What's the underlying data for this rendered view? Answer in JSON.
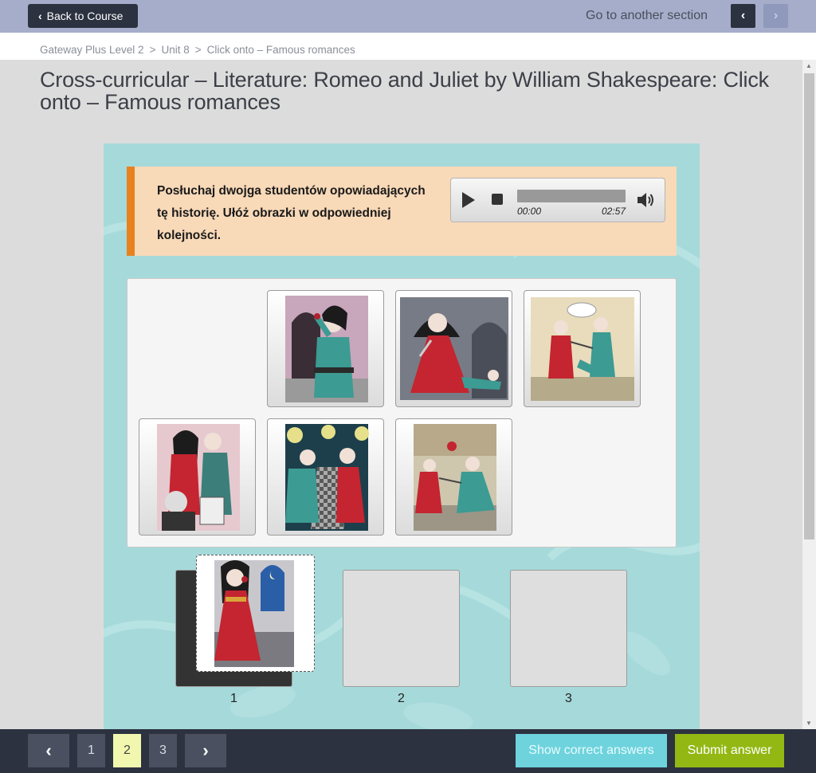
{
  "header": {
    "back_label": "Back to Course",
    "goto_label": "Go to another section",
    "prev_icon": "‹",
    "next_icon": "›"
  },
  "breadcrumb": {
    "items": [
      "Gateway Plus Level 2",
      "Unit 8",
      "Click onto – Famous romances"
    ],
    "separator": ">"
  },
  "page": {
    "title": "Cross-curricular – Literature: Romeo and Juliet by William Shakespeare: Click onto – Famous romances"
  },
  "instructions": {
    "text": "Posłuchaj dwojga studentów opowiadających tę historię. Ułóż obrazki w odpowiedniej kolejności."
  },
  "audio": {
    "current_time": "00:00",
    "total_time": "02:57"
  },
  "cards": [
    {
      "icon": "romeo-drinking-poison-image"
    },
    {
      "icon": "juliet-dagger-image"
    },
    {
      "icon": "sword-fight-image"
    },
    {
      "icon": "wedding-friar-image"
    },
    {
      "icon": "ball-meeting-image"
    },
    {
      "icon": "street-fight-image"
    }
  ],
  "dragged_card": {
    "icon": "juliet-balcony-image"
  },
  "slots": [
    {
      "number": "1",
      "filled": true
    },
    {
      "number": "2",
      "filled": false
    },
    {
      "number": "3",
      "filled": false
    }
  ],
  "pagination": {
    "prev_icon": "‹",
    "next_icon": "›",
    "pages": [
      "1",
      "2",
      "3"
    ],
    "active": "2"
  },
  "actions": {
    "show_answers": "Show correct answers",
    "submit": "Submit answer"
  },
  "colors": {
    "topbar": "#a5adca",
    "dark": "#2c3240",
    "accent_orange": "#e8821f",
    "instruction_bg": "#f8d9b8",
    "panel_bg": "#a6d9da",
    "show_answers_bg": "#6ed3dd",
    "submit_bg": "#93b814",
    "active_page_bg": "#f2f7b0"
  }
}
